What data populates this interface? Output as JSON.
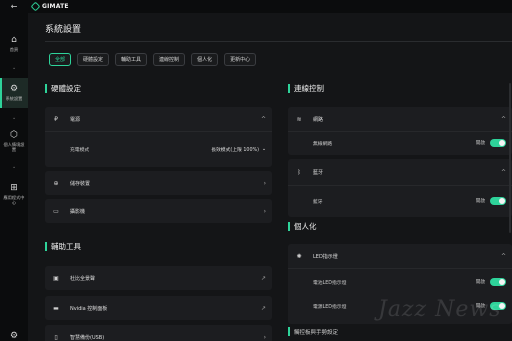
{
  "app": {
    "name": "GIMATE",
    "back_icon": "back-arrow-icon"
  },
  "sidebar": {
    "items": [
      {
        "label": "首頁",
        "icon": "home-icon",
        "glyph": "⌂"
      },
      {
        "label": "系統設置",
        "icon": "gear-icon",
        "glyph": "⚙"
      },
      {
        "label": "個人情境設置",
        "icon": "cube-icon",
        "glyph": "⬡"
      },
      {
        "label": "應用程式中心",
        "icon": "apps-grid-icon",
        "glyph": "⊞"
      }
    ],
    "bottom_icon_glyph": "⚙"
  },
  "page": {
    "title": "系統設置"
  },
  "tabs": [
    "全部",
    "硬體設定",
    "輔助工具",
    "連線控制",
    "個人化",
    "更新中心"
  ],
  "hardware": {
    "title": "硬體設定",
    "power": {
      "label": "電源",
      "charge_mode_label": "充電模式",
      "charge_mode_value": "長效模式(上限 100%)"
    },
    "storage_label": "儲存裝置",
    "camera_label": "攝影機"
  },
  "tools": {
    "title": "輔助工具",
    "items": [
      "杜比全景聲",
      "Nvidia 控制面板",
      "智慧備份(USB)"
    ]
  },
  "connection": {
    "title": "連線控制",
    "network": {
      "label": "網路",
      "wifi_label": "無線網路",
      "wifi_state": "開啟"
    },
    "bluetooth": {
      "label": "藍牙",
      "bt_label": "藍牙",
      "bt_state": "開啟"
    }
  },
  "personalize": {
    "title": "個人化",
    "led": {
      "label": "LED指示燈",
      "power_led_label": "電池LED指示燈",
      "power_led_state": "開啟",
      "power_on_led_label": "電源LED指示燈",
      "power_on_led_state": "開啟"
    },
    "partial_label": "觸控板與手勢設定"
  },
  "watermark": "Jazz News",
  "colors": {
    "accent": "#2ed39a",
    "background": "#141517",
    "card": "#1c1d20",
    "sidebar": "#0b0c0d"
  }
}
